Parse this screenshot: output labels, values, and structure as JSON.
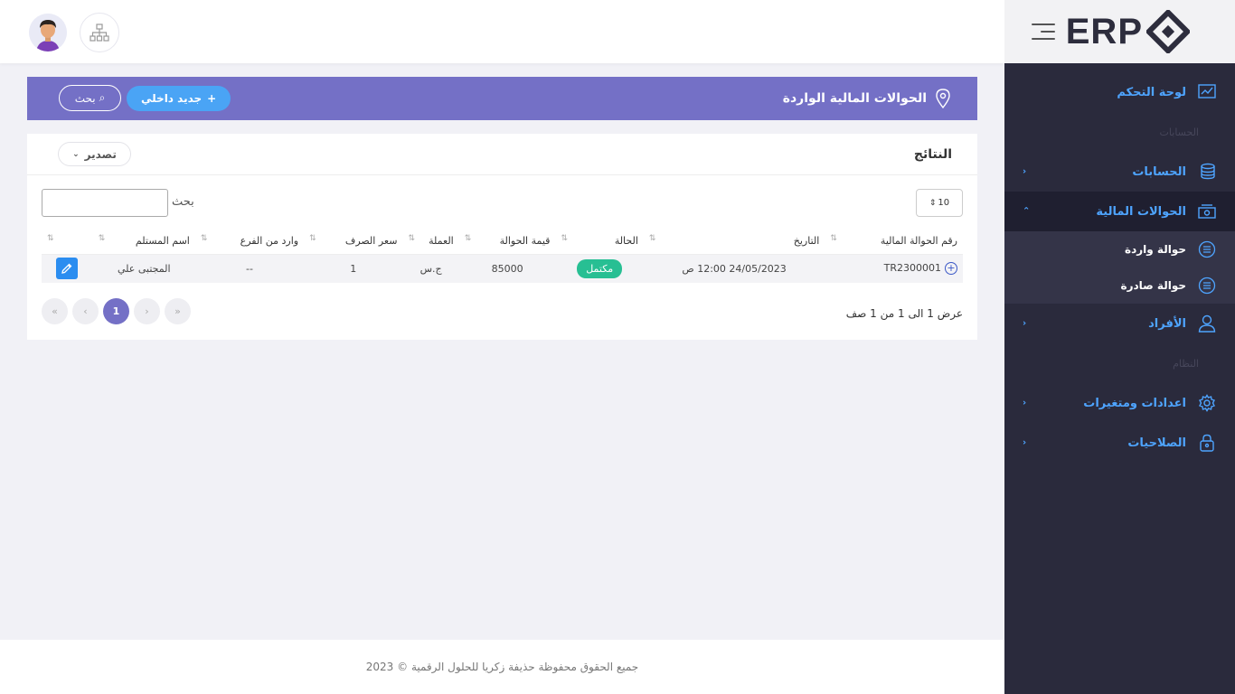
{
  "sidebar": {
    "brand": "ERP",
    "items": [
      {
        "label": "لوحة التحكم"
      },
      {
        "label": "الحسابات"
      },
      {
        "label": "الحوالات المالية"
      },
      {
        "label": "الأفراد"
      },
      {
        "label": "اعدادات ومتغيرات"
      },
      {
        "label": "الصلاحيات"
      }
    ],
    "sections": {
      "accounts": "الحسابات",
      "system": "النظام"
    },
    "subitems": [
      {
        "label": "حوالة واردة"
      },
      {
        "label": "حوالة صادرة"
      }
    ]
  },
  "page": {
    "title": "الحوالات المالية الواردة",
    "new_label": "جديد داخلي",
    "search_label": "بحث"
  },
  "card": {
    "title": "النتائج",
    "export_label": "تصدير",
    "page_size": "10",
    "search_label": "بحث",
    "info": "عرض 1 الى 1 من 1 صف"
  },
  "table": {
    "headers": [
      "رقم الحوالة المالية",
      "التاريخ",
      "الحالة",
      "قيمة الحوالة",
      "العملة",
      "سعر الصرف",
      "وارد من الفرع",
      "اسم المستلم",
      ""
    ],
    "rows": [
      {
        "id": "TR2300001",
        "date": "24/05/2023 12:00 ص",
        "status": "مكتمل",
        "amount": "85000",
        "currency": "ج.س",
        "rate": "1",
        "branch": "--",
        "receiver": "المجتبى علي"
      }
    ]
  },
  "pagination": {
    "current": "1"
  },
  "footer": {
    "text": "جميع الحقوق محفوظة حذيفة زكريا للحلول الرقمية © 2023"
  },
  "colors": {
    "accent": "#7470c6",
    "blue": "#4ea4ff",
    "sidebar": "#2a2a3c",
    "success": "#27bf93"
  }
}
